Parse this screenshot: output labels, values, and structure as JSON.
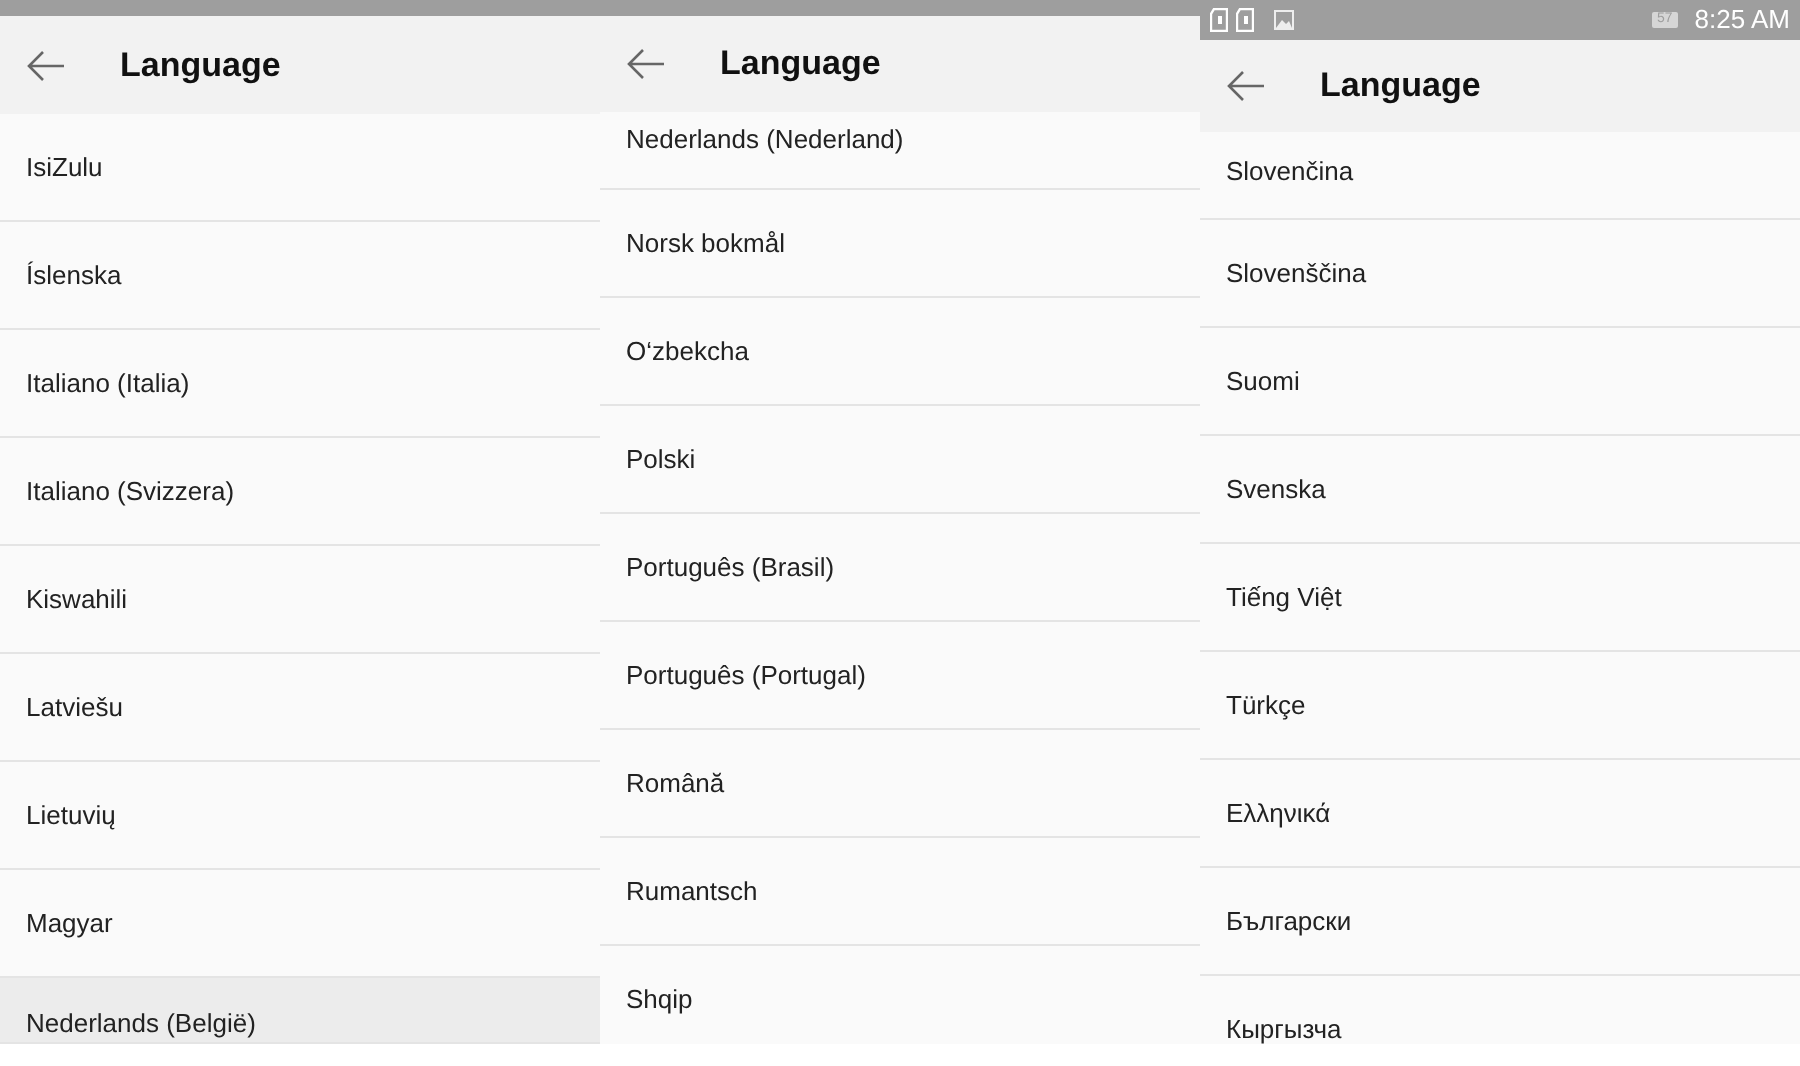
{
  "panels": [
    {
      "header": {
        "title": "Language"
      },
      "items": [
        {
          "label": "IsiZulu",
          "selected": false
        },
        {
          "label": "Íslenska",
          "selected": false
        },
        {
          "label": "Italiano (Italia)",
          "selected": false
        },
        {
          "label": "Italiano (Svizzera)",
          "selected": false
        },
        {
          "label": "Kiswahili",
          "selected": false
        },
        {
          "label": "Latviešu",
          "selected": false
        },
        {
          "label": "Lietuvių",
          "selected": false
        },
        {
          "label": "Magyar",
          "selected": false
        },
        {
          "label": "Nederlands (België)",
          "selected": true
        }
      ]
    },
    {
      "header": {
        "title": "Language"
      },
      "items": [
        {
          "label": "Nederlands (Nederland)",
          "selected": false
        },
        {
          "label": "Norsk bokmål",
          "selected": false
        },
        {
          "label": "O‘zbekcha",
          "selected": false
        },
        {
          "label": "Polski",
          "selected": false
        },
        {
          "label": "Português (Brasil)",
          "selected": false
        },
        {
          "label": "Português (Portugal)",
          "selected": false
        },
        {
          "label": "Română",
          "selected": false
        },
        {
          "label": "Rumantsch",
          "selected": false
        },
        {
          "label": "Shqip",
          "selected": false
        }
      ]
    },
    {
      "status_bar": {
        "battery": "57",
        "time": "8:25 AM"
      },
      "header": {
        "title": "Language"
      },
      "items": [
        {
          "label": "Slovenčina",
          "selected": false
        },
        {
          "label": "Slovenščina",
          "selected": false
        },
        {
          "label": "Suomi",
          "selected": false
        },
        {
          "label": "Svenska",
          "selected": false
        },
        {
          "label": "Tiếng Việt",
          "selected": false
        },
        {
          "label": "Türkçe",
          "selected": false
        },
        {
          "label": "Ελληνικά",
          "selected": false
        },
        {
          "label": "Български",
          "selected": false
        },
        {
          "label": "Кыргызча",
          "selected": false
        }
      ]
    }
  ]
}
